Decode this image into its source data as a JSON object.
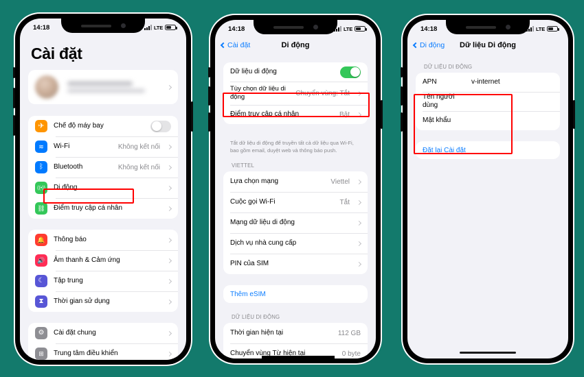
{
  "background_color": "#137a6c",
  "accent_color": "#0a7cff",
  "highlight_color": "#ff0000",
  "toggle_on_color": "#34c759",
  "status_bar": {
    "time": "14:18",
    "network_label": "LTE",
    "signal_icon": "cellular-bars-icon",
    "battery_icon": "battery-icon"
  },
  "phone1": {
    "page_title": "Cài đặt",
    "profile": {
      "name_redacted": true,
      "avatar_icon": "avatar"
    },
    "group1": [
      {
        "label": "Chế độ máy bay",
        "icon": "airplane-icon",
        "icon_color": "#ff9500",
        "glyph": "✈",
        "control": "toggle",
        "toggle_on": false
      },
      {
        "label": "Wi-Fi",
        "icon": "wifi-icon",
        "icon_color": "#007aff",
        "glyph": "◔",
        "value": "Không kết nối",
        "control": "chevron"
      },
      {
        "label": "Bluetooth",
        "icon": "bluetooth-icon",
        "icon_color": "#007aff",
        "glyph": "ᛦ",
        "value": "Không kết nối",
        "control": "chevron"
      },
      {
        "label": "Di động",
        "icon": "cellular-icon",
        "icon_color": "#34c759",
        "glyph": "((•))",
        "value": "",
        "control": "chevron",
        "highlighted": true
      },
      {
        "label": "Điểm truy cập cá nhân",
        "icon": "hotspot-icon",
        "icon_color": "#34c759",
        "glyph": "♾",
        "value": "",
        "control": "chevron"
      }
    ],
    "group2": [
      {
        "label": "Thông báo",
        "icon": "notifications-icon",
        "icon_color": "#ff3b30",
        "glyph": "ὑ4",
        "control": "chevron"
      },
      {
        "label": "Âm thanh & Cảm ứng",
        "icon": "sounds-haptics-icon",
        "icon_color": "#ff2d55",
        "glyph": "ὐa",
        "control": "chevron"
      },
      {
        "label": "Tập trung",
        "icon": "focus-icon",
        "icon_color": "#5856d6",
        "glyph": "☾",
        "control": "chevron"
      },
      {
        "label": "Thời gian sử dụng",
        "icon": "screen-time-icon",
        "icon_color": "#5856d6",
        "glyph": "⧗",
        "control": "chevron"
      }
    ],
    "group3": [
      {
        "label": "Cài đặt chung",
        "icon": "general-settings-icon",
        "icon_color": "#8e8e93",
        "glyph": "⚙",
        "control": "chevron"
      },
      {
        "label": "Trung tâm điều khiển",
        "icon": "control-center-icon",
        "icon_color": "#8e8e93",
        "glyph": "☰",
        "control": "chevron",
        "redacted": true
      }
    ]
  },
  "phone2": {
    "back_label": "Cài đặt",
    "nav_title": "Di động",
    "group1": [
      {
        "label": "Dữ liệu di động",
        "control": "toggle",
        "toggle_on": true
      },
      {
        "label": "Tùy chọn dữ liệu di động",
        "value": "Chuyển vùng: Tắt",
        "control": "chevron",
        "highlighted": true
      },
      {
        "label": "Điểm truy cập cá nhân",
        "value": "Bật",
        "control": "chevron"
      }
    ],
    "footnote": "Tắt dữ liệu di động để truyền tất cả dữ liệu qua Wi-Fi, bao gồm email, duyệt web và thông báo push.",
    "section_carrier": "VIETTEL",
    "group2": [
      {
        "label": "Lựa chọn mạng",
        "value": "Viettel",
        "control": "chevron"
      },
      {
        "label": "Cuộc gọi Wi-Fi",
        "value": "Tắt",
        "control": "chevron"
      },
      {
        "label": "Mạng dữ liệu di động",
        "value": "",
        "control": "chevron"
      },
      {
        "label": "Dịch vụ nhà cung cấp",
        "value": "",
        "control": "chevron"
      },
      {
        "label": "PIN của SIM",
        "value": "",
        "control": "chevron"
      }
    ],
    "add_esim_label": "Thêm eSIM",
    "section_data": "DỮ LIỆU DI ĐỘNG",
    "group3": [
      {
        "label": "Thời gian hiện tại",
        "value": "112 GB"
      },
      {
        "label": "Chuyển vùng Từ hiện tại",
        "value": "0 byte",
        "redacted": true
      }
    ]
  },
  "phone3": {
    "back_label": "Di động",
    "nav_title": "Dữ liệu Di động",
    "section_data": "DỮ LIỆU DI ĐỘNG",
    "fields": [
      {
        "label": "APN",
        "value": "v-internet"
      },
      {
        "label": "Tên người dùng",
        "value": ""
      },
      {
        "label": "Mật khẩu",
        "value": ""
      }
    ],
    "reset_label": "Đặt lại Cài đặt"
  }
}
